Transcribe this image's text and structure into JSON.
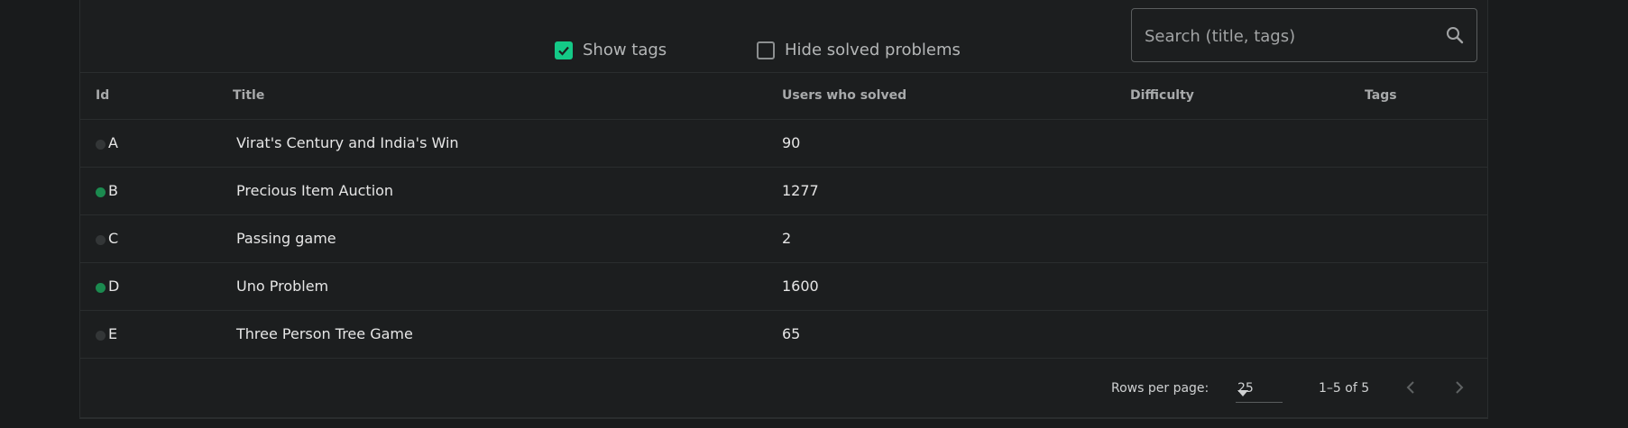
{
  "toolbar": {
    "show_tags": {
      "label": "Show tags",
      "checked": true
    },
    "hide_solved": {
      "label": "Hide solved problems",
      "checked": false
    },
    "search": {
      "placeholder": "Search (title, tags)",
      "value": "",
      "icon": "search-icon"
    }
  },
  "table": {
    "headers": {
      "id": "Id",
      "title": "Title",
      "users_solved": "Users who solved",
      "difficulty": "Difficulty",
      "tags": "Tags"
    },
    "rows": [
      {
        "id": "A",
        "title": "Virat's Century and India's Win",
        "users_solved": "90",
        "difficulty": "",
        "tags": "",
        "solved": false
      },
      {
        "id": "B",
        "title": "Precious Item Auction",
        "users_solved": "1277",
        "difficulty": "",
        "tags": "",
        "solved": true
      },
      {
        "id": "C",
        "title": "Passing game",
        "users_solved": "2",
        "difficulty": "",
        "tags": "",
        "solved": false
      },
      {
        "id": "D",
        "title": "Uno Problem",
        "users_solved": "1600",
        "difficulty": "",
        "tags": "",
        "solved": true
      },
      {
        "id": "E",
        "title": "Three Person Tree Game",
        "users_solved": "65",
        "difficulty": "",
        "tags": "",
        "solved": false
      }
    ]
  },
  "pagination": {
    "rows_per_page_label": "Rows per page:",
    "rows_per_page_value": "25",
    "range_text": "1–5 of 5",
    "prev_icon": "chevron-left-icon",
    "next_icon": "chevron-right-icon"
  },
  "colors": {
    "accent": "#14c987",
    "solved_dot": "#1b8a4f",
    "unsolved_dot": "#333637",
    "background": "#191b1c"
  }
}
